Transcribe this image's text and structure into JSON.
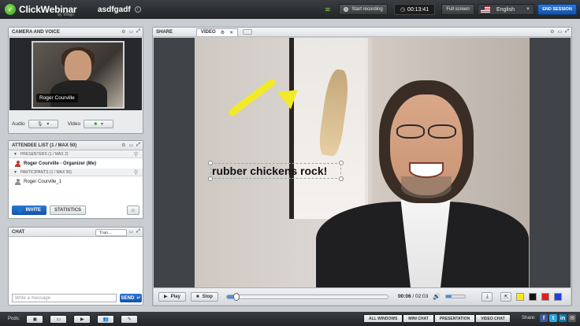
{
  "topbar": {
    "logo": "ClickWebinar",
    "logo_sub": "by Vlingo",
    "session_name": "asdfgadf",
    "record_label": "Start recording",
    "timer": "00:13:41",
    "fullscreen_label": "Full screen",
    "language": "English",
    "end_session_label": "END SESSION"
  },
  "camera": {
    "title": "CAMERA AND VOICE",
    "presenter_name": "Roger Courville",
    "audio_label": "Audio",
    "video_label": "Video"
  },
  "attendees": {
    "title": "ATTENDEE LIST (1 / MAX 50)",
    "presenters_header": "PRESENTERS (1 / MAX 2)",
    "presenters": [
      "Roger Courville - Organizer (Me)"
    ],
    "participants_header": "PARTICIPANTS (1 / MAX 50)",
    "participants": [
      "Roger Courville_1"
    ],
    "invite_label": "INVITE",
    "statistics_label": "STATISTICS"
  },
  "chat": {
    "title": "CHAT",
    "translate_label": "Tran...",
    "input_placeholder": "Write a message",
    "send_label": "SEND"
  },
  "share": {
    "title": "SHARE",
    "tab_label": "VIDEO",
    "annotation_text": "rubber chickens rock!",
    "play_label": "Play",
    "stop_label": "Stop",
    "elapsed": "00:06",
    "total": "02:03",
    "progress": 0.05,
    "volume": 0.3,
    "swatches": [
      "#f5ea14",
      "#111111",
      "#e01f1f",
      "#1f3fe0"
    ]
  },
  "bottombar": {
    "pods_label": "Pods:",
    "layouts": [
      "ALL WINDOWS",
      "MINI CHAT",
      "PRESENTATION",
      "VIDEO CHAT"
    ],
    "active_layout": "VIDEO CHAT",
    "share_label": "Share:"
  },
  "colors": {
    "accent": "#1f66c4",
    "annotation": "#f2ea28"
  }
}
